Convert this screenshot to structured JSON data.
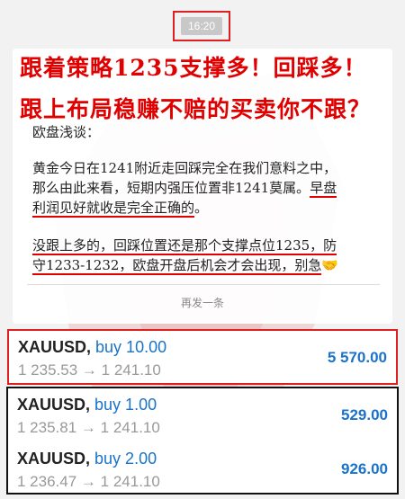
{
  "chat": {
    "timestamp": "16:20",
    "headline_1": "跟着策略1235支撑多！回踩多！",
    "headline_2": "跟上布局稳赚不赔的买卖你不跟？",
    "section_title": "欧盘浅谈：",
    "para1_line1": "黄金今日在1241附近走回踩完全在我们意料之中，",
    "para1_line2a": "那么由此来看，短期内强压位置非1241莫属。",
    "para1_line2b": "早盘",
    "para1_line3": "利润见好就收是完全正确的",
    "para1_line3_end": "。",
    "para2_line1": "没跟上多的，回踩位置还是那个支撑点位1235，防",
    "para2_line2": "守1233-1232，欧盘开盘后机会才会出现，别急",
    "emoji": "🤝",
    "more_link": "再发一条"
  },
  "trades": [
    {
      "symbol": "XAUUSD,",
      "direction": "buy 10.00",
      "price_open": "1 235.53",
      "arrow": "→",
      "price_close": "1 241.10",
      "profit": "5 570.00"
    },
    {
      "symbol": "XAUUSD,",
      "direction": "buy 1.00",
      "price_open": "1 235.81",
      "arrow": "→",
      "price_close": "1 241.10",
      "profit": "529.00"
    },
    {
      "symbol": "XAUUSD,",
      "direction": "buy 2.00",
      "price_open": "1 236.47",
      "arrow": "→",
      "price_close": "1 241.10",
      "profit": "926.00"
    }
  ],
  "colors": {
    "highlight_red": "#e02020",
    "profit_blue": "#1a73c8",
    "price_gray": "#999999"
  }
}
